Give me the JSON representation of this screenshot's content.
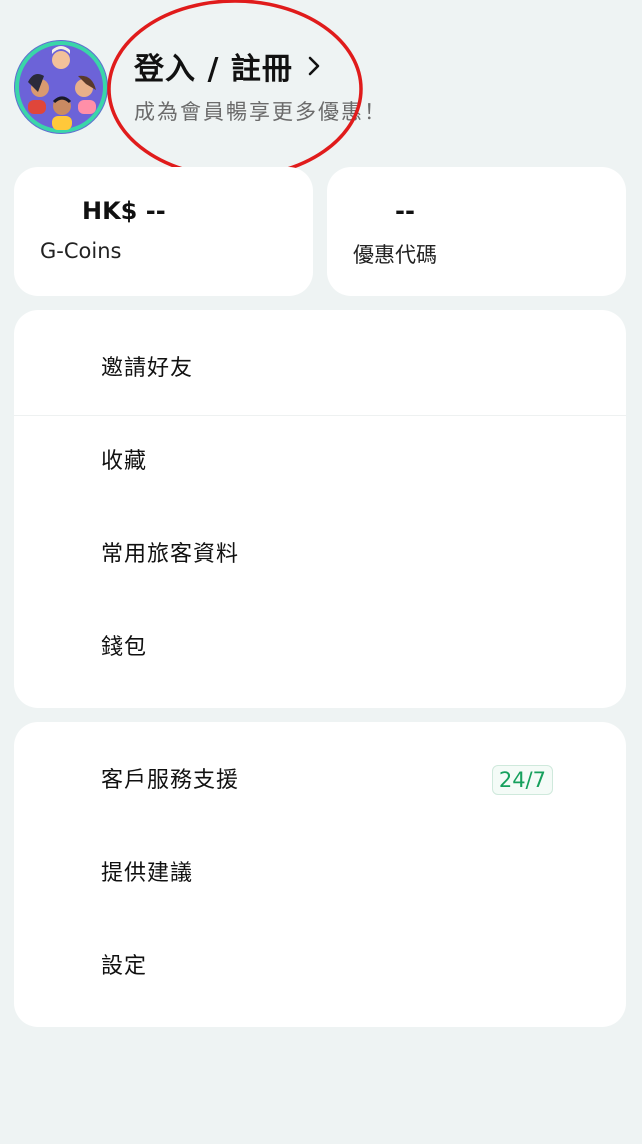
{
  "header": {
    "login_label": "登入 / 註冊",
    "subtitle": "成為會員暢享更多優惠！"
  },
  "stats": {
    "balance": {
      "value": "HK$ --",
      "label": "G-Coins"
    },
    "promo": {
      "value": "--",
      "label": "優惠代碼"
    }
  },
  "menu_group_1": [
    {
      "label": "邀請好友"
    },
    {
      "label": "收藏"
    },
    {
      "label": "常用旅客資料"
    },
    {
      "label": "錢包"
    }
  ],
  "menu_group_2": [
    {
      "label": "客戶服務支援",
      "badge": "24/7"
    },
    {
      "label": "提供建議"
    },
    {
      "label": "設定"
    }
  ],
  "colors": {
    "background": "#eef3f3",
    "accent": "#16a05d",
    "annotation": "#e01b1b"
  },
  "icons": {
    "avatar": "group-avatar-illustration",
    "chevron": "chevron-right-icon"
  }
}
